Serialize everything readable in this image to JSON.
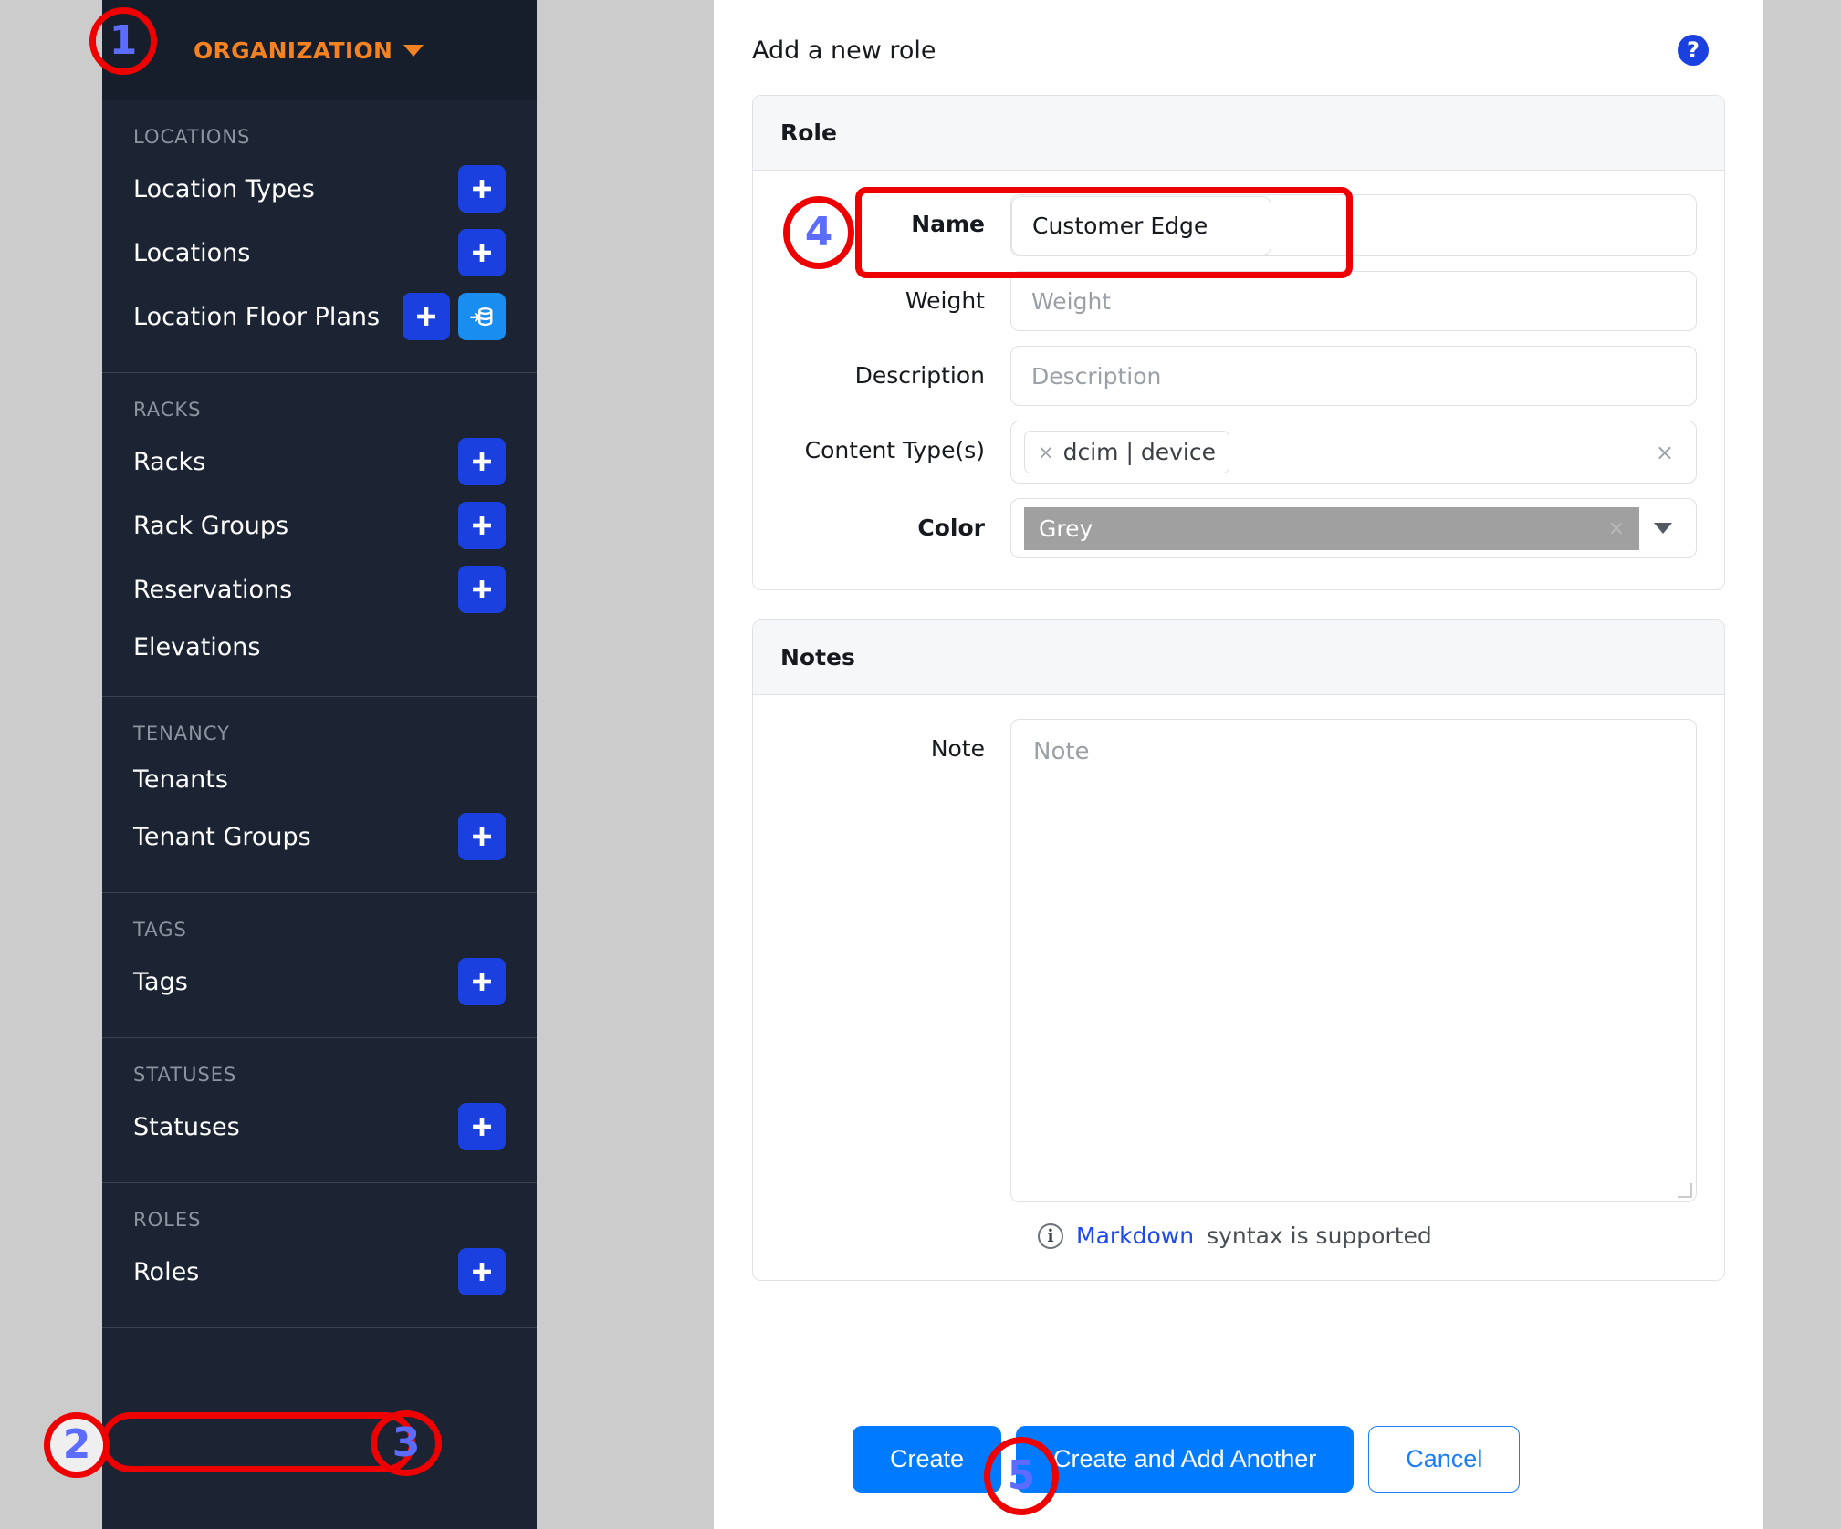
{
  "sidebar": {
    "org_title": "ORGANIZATION",
    "sections": [
      {
        "title": "LOCATIONS",
        "items": [
          {
            "label": "Location Types",
            "add": true,
            "import": false
          },
          {
            "label": "Locations",
            "add": true,
            "import": false
          },
          {
            "label": "Location Floor Plans",
            "add": true,
            "import": true
          }
        ]
      },
      {
        "title": "RACKS",
        "items": [
          {
            "label": "Racks",
            "add": true,
            "import": false
          },
          {
            "label": "Rack Groups",
            "add": true,
            "import": false
          },
          {
            "label": "Reservations",
            "add": true,
            "import": false
          },
          {
            "label": "Elevations",
            "add": false,
            "import": false
          }
        ]
      },
      {
        "title": "TENANCY",
        "items": [
          {
            "label": "Tenants",
            "add": false,
            "import": false
          },
          {
            "label": "Tenant Groups",
            "add": true,
            "import": false
          }
        ]
      },
      {
        "title": "TAGS",
        "items": [
          {
            "label": "Tags",
            "add": true,
            "import": false
          }
        ]
      },
      {
        "title": "STATUSES",
        "items": [
          {
            "label": "Statuses",
            "add": true,
            "import": false
          }
        ]
      },
      {
        "title": "ROLES",
        "items": [
          {
            "label": "Roles",
            "add": true,
            "import": false
          }
        ]
      }
    ]
  },
  "main": {
    "title": "Add a new role",
    "help_icon": "help-circle-icon",
    "role_card": {
      "heading": "Role",
      "fields": {
        "name_label": "Name",
        "name_value": "Customer Edge",
        "weight_label": "Weight",
        "weight_placeholder": "Weight",
        "description_label": "Description",
        "description_placeholder": "Description",
        "content_types_label": "Content Type(s)",
        "content_types_token": "dcim | device",
        "token_remove": "×",
        "clear_all": "×",
        "color_label": "Color",
        "color_value": "Grey",
        "color_clear": "×"
      }
    },
    "notes_card": {
      "heading": "Notes",
      "note_label": "Note",
      "note_placeholder": "Note",
      "markdown_link": "Markdown",
      "markdown_rest": "syntax is supported",
      "info_glyph": "i"
    },
    "footer": {
      "create": "Create",
      "create_add_another": "Create and Add Another",
      "cancel": "Cancel"
    }
  },
  "annotations": {
    "one": "1",
    "two": "2",
    "three": "3",
    "four": "4",
    "five": "5"
  },
  "colors": {
    "sidebar_bg": "#1c2434",
    "sidebar_header_bg": "#171e2b",
    "org_orange": "#f58220",
    "add_button_blue": "#1a41e0",
    "import_button_blue": "#1a8df0",
    "primary_button_blue": "#007bff",
    "annotation_red": "#ee0000",
    "annotation_number_blue": "#5c6cff",
    "page_bg": "#cccccc",
    "swatch_grey": "#a0a0a0",
    "link_blue": "#1b49ea"
  }
}
